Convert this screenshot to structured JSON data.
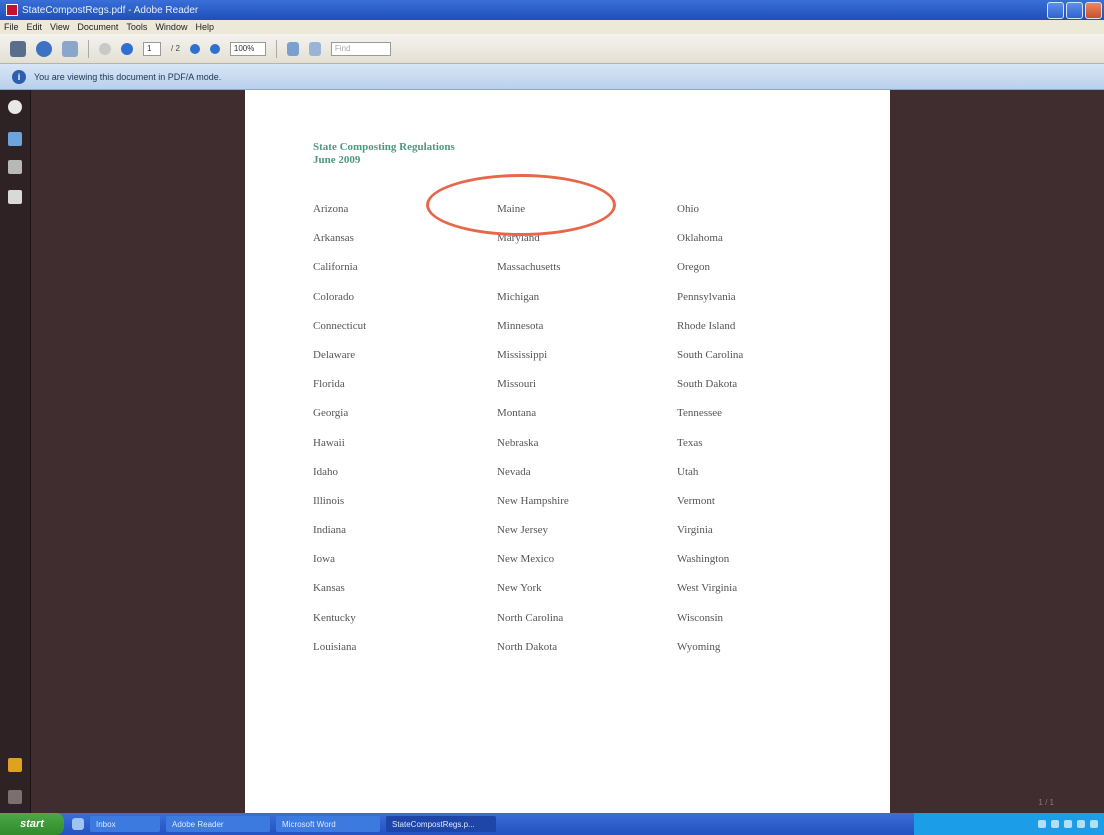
{
  "window": {
    "title": "StateCompostRegs.pdf - Adobe Reader"
  },
  "menu": [
    "File",
    "Edit",
    "View",
    "Document",
    "Tools",
    "Window",
    "Help"
  ],
  "toolbar": {
    "page_current": "1",
    "page_total": "/ 2",
    "zoom": "100%",
    "find_placeholder": "Find"
  },
  "infobar": {
    "text": "You are viewing this document in PDF/A mode."
  },
  "document": {
    "title_line1": "State Composting Regulations",
    "title_line2": "June 2009",
    "col1": [
      "Arizona",
      "Arkansas",
      "California",
      "Colorado",
      "Connecticut",
      "Delaware",
      "Florida",
      "Georgia",
      "Hawaii",
      "Idaho",
      "Illinois",
      "Indiana",
      "Iowa",
      "Kansas",
      "Kentucky",
      "Louisiana"
    ],
    "col2": [
      "Maine",
      "Maryland",
      "Massachusetts",
      "Michigan",
      "Minnesota",
      "Mississippi",
      "Missouri",
      "Montana",
      "Nebraska",
      "Nevada",
      "New Hampshire",
      "New Jersey",
      "New Mexico",
      "New York",
      "North Carolina",
      "North Dakota"
    ],
    "col3": [
      "Ohio",
      "Oklahoma",
      "Oregon",
      "Pennsylvania",
      "Rhode Island",
      "South Carolina",
      "South Dakota",
      "Tennessee",
      "Texas",
      "Utah",
      "Vermont",
      "Virginia",
      "Washington",
      "West Virginia",
      "Wisconsin",
      "Wyoming"
    ],
    "highlighted": "Maine",
    "page_indicator": "1 / 1"
  },
  "taskbar": {
    "start": "start",
    "tasks": [
      "Inbox",
      "Adobe Reader",
      "Microsoft Word",
      "StateCompostRegs.p..."
    ]
  },
  "colors": {
    "title": "#4a9a7e",
    "circle": "#e8664a",
    "pane": "#3f2d30"
  }
}
